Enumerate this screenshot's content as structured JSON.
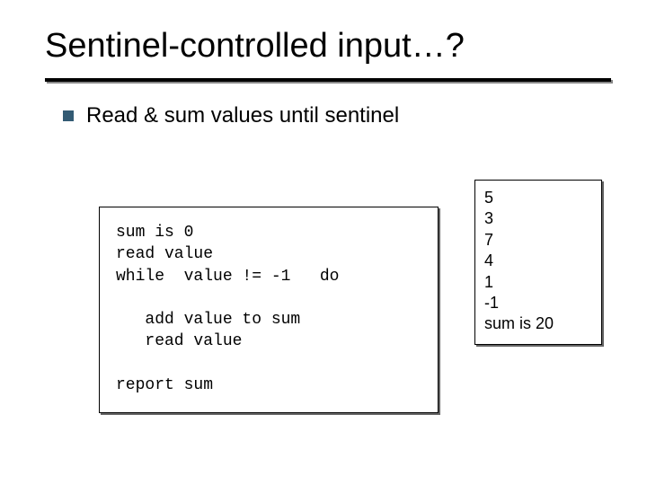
{
  "title": "Sentinel-controlled input…?",
  "bullet": "Read & sum values until sentinel",
  "code": "sum is 0\nread value\nwhile  value != -1   do\n\n   add value to sum\n   read value\n\nreport sum",
  "output": "5\n3\n7\n4\n1\n-1\nsum is 20"
}
